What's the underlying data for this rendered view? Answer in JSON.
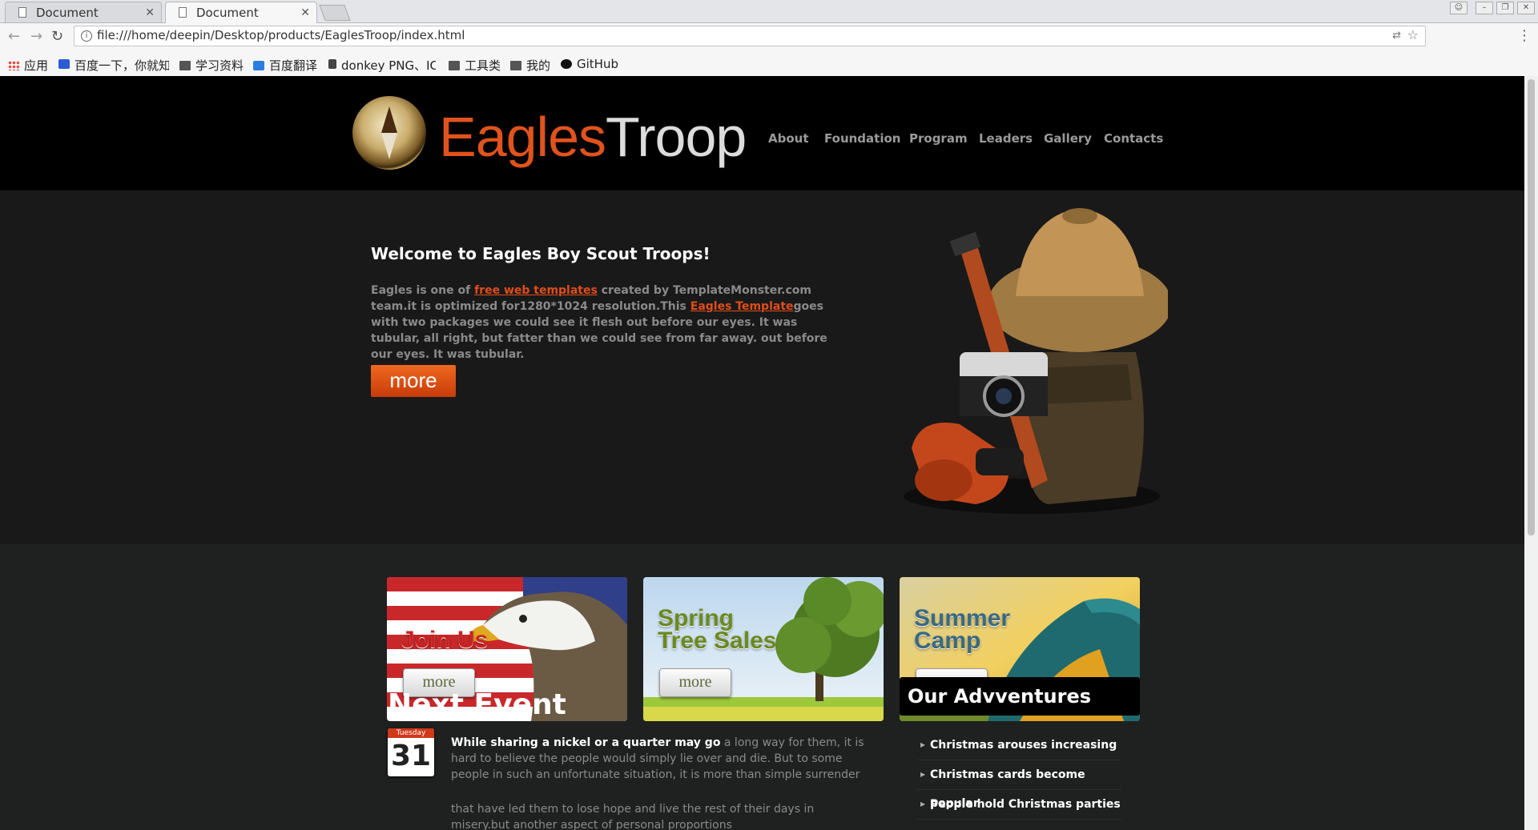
{
  "browser": {
    "tabs": [
      {
        "label": "Document"
      },
      {
        "label": "Document"
      }
    ],
    "url": "file:///home/deepin/Desktop/products/EaglesTroop/index.html",
    "bookmarks": [
      {
        "label": "应用",
        "icon": "apps-icon"
      },
      {
        "label": "百度一下，你就知",
        "icon": "baidu-icon"
      },
      {
        "label": "学习资料",
        "icon": "folder-icon"
      },
      {
        "label": "百度翻译",
        "icon": "translate-icon"
      },
      {
        "label": "donkey PNG、IC",
        "icon": "donkey-icon"
      },
      {
        "label": "工具类",
        "icon": "folder-icon"
      },
      {
        "label": "我的",
        "icon": "folder-icon"
      },
      {
        "label": "GitHub",
        "icon": "github-icon"
      }
    ]
  },
  "site": {
    "logo": {
      "eagles": "Eagles",
      "troop": "Troop"
    },
    "nav": [
      "About",
      "Foundation",
      "Program",
      "Leaders",
      "Gallery",
      "Contacts"
    ],
    "hero": {
      "title": "Welcome to Eagles Boy Scout Troops!",
      "p1": "Eagles is one of ",
      "link1": "free web templates",
      "p2": " created by TemplateMonster.com team.it is optimized for1280*1024 resolution.This ",
      "link2": "Eagles Template",
      "p3": "goes with two packages we could see it flesh out before our eyes. It was tubular, all right, but fatter than we could see from far away. out before our eyes. It was tubular.",
      "more": "more"
    },
    "banners": [
      {
        "line1": "Join Us",
        "line2": "",
        "more": "more"
      },
      {
        "line1": "Spring",
        "line2": "Tree Sales",
        "more": "more"
      },
      {
        "line1": "Summer",
        "line2": "Camp",
        "more": "more"
      }
    ],
    "next_event": {
      "title": "Next Event",
      "cal_day": "Tuesday",
      "cal_num": "31",
      "lead": "While sharing a nickel or a quarter may go",
      "rest": " a long way for them, it is hard to believe the people would simply lie over and die. But to some people in such an unfortunate situation, it is more than simple surrender",
      "para2": "that have led them to lose hope and live the rest of their days in misery.but another aspect of personal proportions"
    },
    "adventures": {
      "title": "Our Advventures",
      "items": [
        "Christmas arouses increasing",
        "Christmas cards become popular",
        "People hold Christmas parties"
      ]
    }
  }
}
